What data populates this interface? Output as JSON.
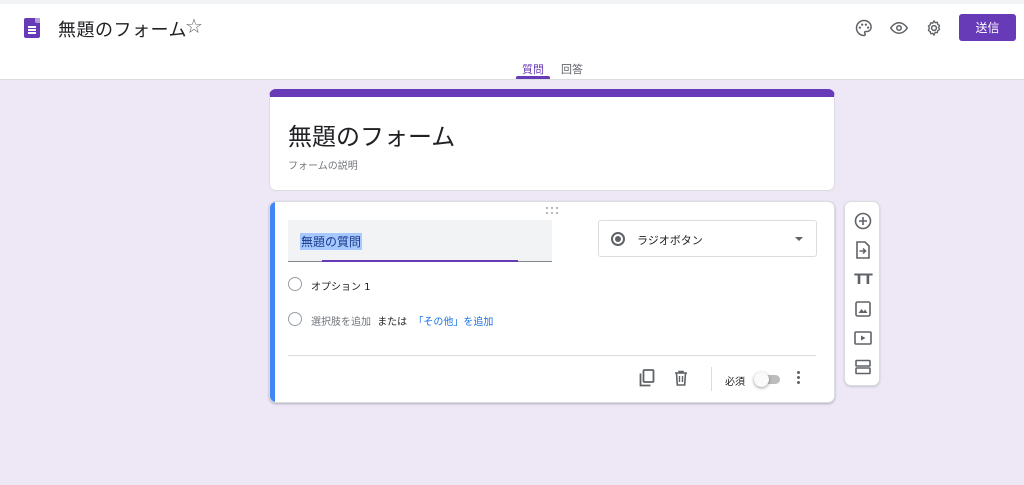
{
  "header": {
    "form_name": "無題のフォーム",
    "send_label": "送信",
    "icons": [
      "palette-icon",
      "eye-icon",
      "gear-icon"
    ],
    "accent_color": "#673ab7"
  },
  "tabs": [
    {
      "label": "質問",
      "active": true
    },
    {
      "label": "回答",
      "active": false
    }
  ],
  "title_card": {
    "title": "無題のフォーム",
    "description": "フォームの説明"
  },
  "question": {
    "title": "無題の質問",
    "type_label": "ラジオボタン",
    "options": [
      "オプション 1"
    ],
    "add_option_text": "選択肢を追加",
    "or_text": "または",
    "add_other_text": "「その他」を追加",
    "required_label": "必須",
    "required": false
  },
  "side_toolbar": {
    "items": [
      "add-question-icon",
      "import-questions-icon",
      "add-title-icon",
      "add-image-icon",
      "add-video-icon",
      "add-section-icon"
    ]
  }
}
